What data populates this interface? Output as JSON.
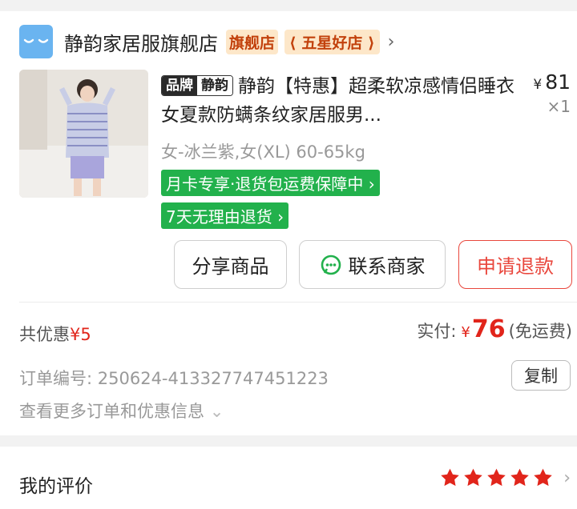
{
  "store": {
    "name": "静韵家居服旗舰店",
    "badge_flagship": "旗舰店",
    "badge_star": "五星好店"
  },
  "product": {
    "brand_tag_key": "品牌",
    "brand_tag_value": "静韵",
    "title": "静韵【特惠】超柔软凉感情侣睡衣女夏款防螨条纹家居服男...",
    "unit_price_currency": "¥",
    "unit_price": "81",
    "quantity": "×1",
    "variant": "女-冰兰紫,女(XL) 60-65kg",
    "tags": [
      "月卡专享·退货包运费保障中",
      "7天无理由退货"
    ]
  },
  "actions": {
    "share": "分享商品",
    "contact": "联系商家",
    "refund": "申请退款"
  },
  "summary": {
    "discount_label": "共优惠",
    "discount_value": "¥5",
    "paid_label": "实付:",
    "paid_currency": "¥",
    "paid_amount": "76",
    "shipping_note": "(免运费)"
  },
  "order": {
    "number_label": "订单编号:",
    "number": "250624-413327747451223",
    "copy_label": "复制",
    "more_link": "查看更多订单和优惠信息"
  },
  "review": {
    "title": "我的评价",
    "rating": 5
  },
  "colors": {
    "accent_red": "#e1251b",
    "green_tag": "#22b14c",
    "store_logo": "#6ab4f0"
  }
}
